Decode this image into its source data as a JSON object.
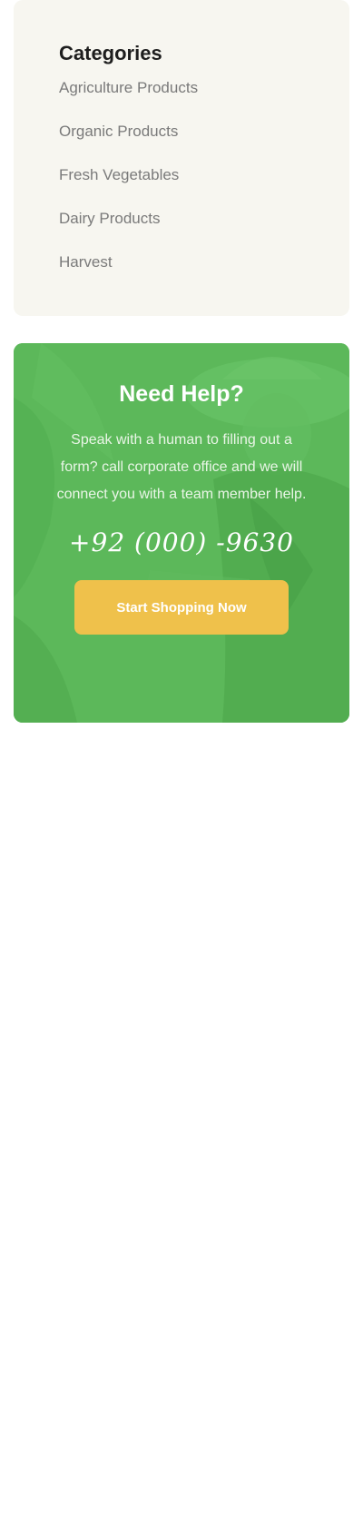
{
  "categories": {
    "title": "Categories",
    "items": [
      "Agriculture Products",
      "Organic Products",
      "Fresh Vegetables",
      "Dairy Products",
      "Harvest"
    ]
  },
  "help": {
    "title": "Need Help?",
    "text": "Speak with a human to filling out a form? call corporate office and we will connect you with a team member help.",
    "phone": "+92 (000) -9630",
    "button_label": "Start Shopping Now"
  },
  "colors": {
    "category_bg": "#f7f6f0",
    "help_green": "#5cb85a",
    "button_yellow": "#efc14b"
  }
}
